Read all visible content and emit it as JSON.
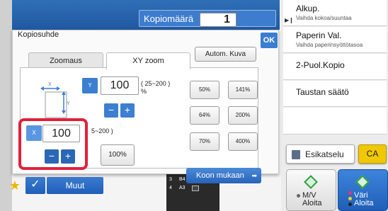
{
  "header": {
    "copies_label": "Kopiomäärä",
    "copies_value": "1"
  },
  "right_panel": {
    "items": [
      {
        "title": "Alkup.",
        "subtitle": "Vaihda kokoa/suuntaa"
      },
      {
        "title": "Paperin Val.",
        "subtitle": "Vaihda paperinsyöttötasoa"
      },
      {
        "title": "2-Puol.Kopio",
        "subtitle": ""
      },
      {
        "title": "Taustan säätö",
        "subtitle": ""
      }
    ],
    "preview_label": "Esikatselu",
    "ca_label": "CA",
    "mv_label1": "M/V",
    "mv_label2": "Aloita",
    "color_label1": "Väri",
    "color_label2": "Aloita"
  },
  "dialog": {
    "title": "Kopiosuhde",
    "ok_label": "OK",
    "tabs": [
      "Zoomaus",
      "XY zoom"
    ],
    "auto_label": "Autom. Kuva",
    "y_letter": "Y",
    "y_value": "100",
    "y_range": "( 25~200 )",
    "y_unit": "%",
    "x_letter": "X",
    "x_value": "100",
    "x_range": "5~200 )",
    "minus": "−",
    "plus": "+",
    "presets": [
      "50%",
      "141%",
      "64%",
      "200%",
      "70%",
      "400%"
    ],
    "btn100": "100%",
    "fit_label": "Koon mukaan"
  },
  "bottom": {
    "muut_label": "Muut",
    "trays": [
      {
        "num": "3",
        "size": "B4"
      },
      {
        "num": "4",
        "size": "A3"
      }
    ]
  },
  "colors": {
    "accent": "#2f6fb6",
    "highlight": "#e0203a",
    "ca": "#f0c800"
  }
}
